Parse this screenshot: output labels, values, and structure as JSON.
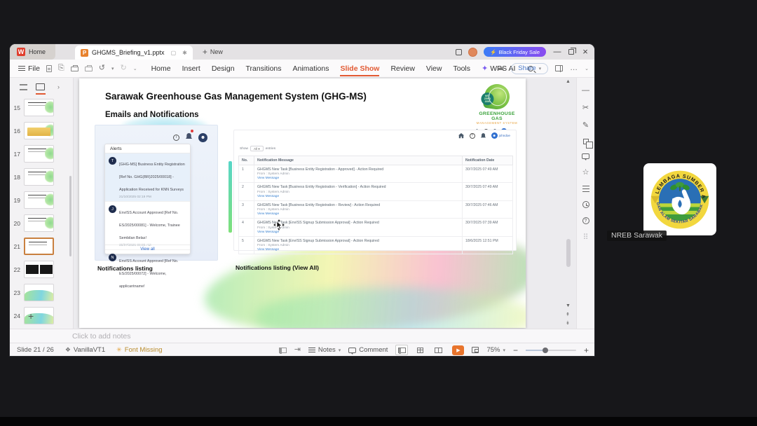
{
  "meeting": {
    "participant_name": "NREB Sarawak",
    "participant_logo": {
      "arc_top": "LEMBAGA SUMBER ASLI",
      "arc_bottom": "DAN ALAM SEKITAR SARAWAK"
    }
  },
  "titlebar": {
    "home_tab": "Home",
    "doc_tab": "GHGMS_Briefing_v1.pptx",
    "new_tab": "New",
    "promo": "Black Friday Sale"
  },
  "menubar": {
    "file": "File",
    "items": [
      "Home",
      "Insert",
      "Design",
      "Transitions",
      "Animations",
      "Slide Show",
      "Review",
      "View",
      "Tools"
    ],
    "active_item": "Slide Show",
    "wps_ai": "WPS AI",
    "share": "Share"
  },
  "slide_panel": {
    "numbers": [
      "15",
      "16",
      "17",
      "18",
      "19",
      "20",
      "21",
      "22",
      "23",
      "24"
    ],
    "selected": "21",
    "add_label": "+"
  },
  "slide": {
    "title": "Sarawak Greenhouse Gas Management System (GHG-MS)",
    "subtitle": "Emails and Notifications",
    "brand": {
      "badge": [
        "NET",
        "ZERO",
        "2050"
      ],
      "name": "GREENHOUSE GAS",
      "tagline": "MANAGEMENT SYSTEM"
    },
    "captions": {
      "left": "Notifications listing",
      "right": "Notifications listing (View All)"
    },
    "alerts": {
      "header": "Alerts",
      "view_all": "View all",
      "items": [
        {
          "avatar": "T",
          "text": "[GHG-MS] Business Entity Registration [Ref No. GHG(BR)2025/00018] - Application Received for KNN Surveys",
          "time": "21/10/2025 02:19 PM"
        },
        {
          "avatar": "J",
          "text": "EnvISS Account Approved [Ref No. ES/2025/00081] - Welcome, Trainee Sembilan Belas!",
          "time": "30/07/2025 09:09 AM"
        },
        {
          "avatar": "N",
          "text": "EnvISS Account Approved [Ref No. ES/2025/00072] - Welcome, applicantname!",
          "time": ""
        }
      ]
    },
    "table": {
      "user": "johndoe",
      "show": "Show",
      "show_value": "All",
      "entries": "entries",
      "headers": [
        "No.",
        "Notification Message",
        "Notification Date"
      ],
      "rows": [
        {
          "no": "1",
          "message": "GHGMS New Task [Business Entity Registration - Approved] - Action Required",
          "from": "From : System Admin",
          "link": "View Message",
          "date": "30/7/2025 07:49 AM"
        },
        {
          "no": "2",
          "message": "GHGMS New Task [Business Entity Registration - Verification] - Action Required",
          "from": "From : System Admin",
          "link": "View Message",
          "date": "30/7/2025 07:49 AM"
        },
        {
          "no": "3",
          "message": "GHGMS New Task [Business Entity Registration - Review] - Action Required",
          "from": "From : System Admin",
          "link": "View Message",
          "date": "30/7/2025 07:46 AM"
        },
        {
          "no": "4",
          "message": "GHGMS New Task [EnvISS Signup Submission Approval] - Action Required",
          "from": "From : System Admin",
          "link": "View Message",
          "date": "30/7/2025 07:39 AM"
        },
        {
          "no": "5",
          "message": "GHGMS New Task [EnvISS Signup Submission Approval] - Action Required",
          "from": "From : System Admin",
          "link": "View Message",
          "date": "18/6/2025 12:51 PM"
        }
      ]
    }
  },
  "notes": {
    "placeholder": "Click to add notes"
  },
  "statusbar": {
    "slide_info": "Slide 21 / 26",
    "theme": "VanillaVT1",
    "font_warning": "Font Missing",
    "notes": "Notes",
    "comment": "Comment",
    "zoom": "75%"
  }
}
